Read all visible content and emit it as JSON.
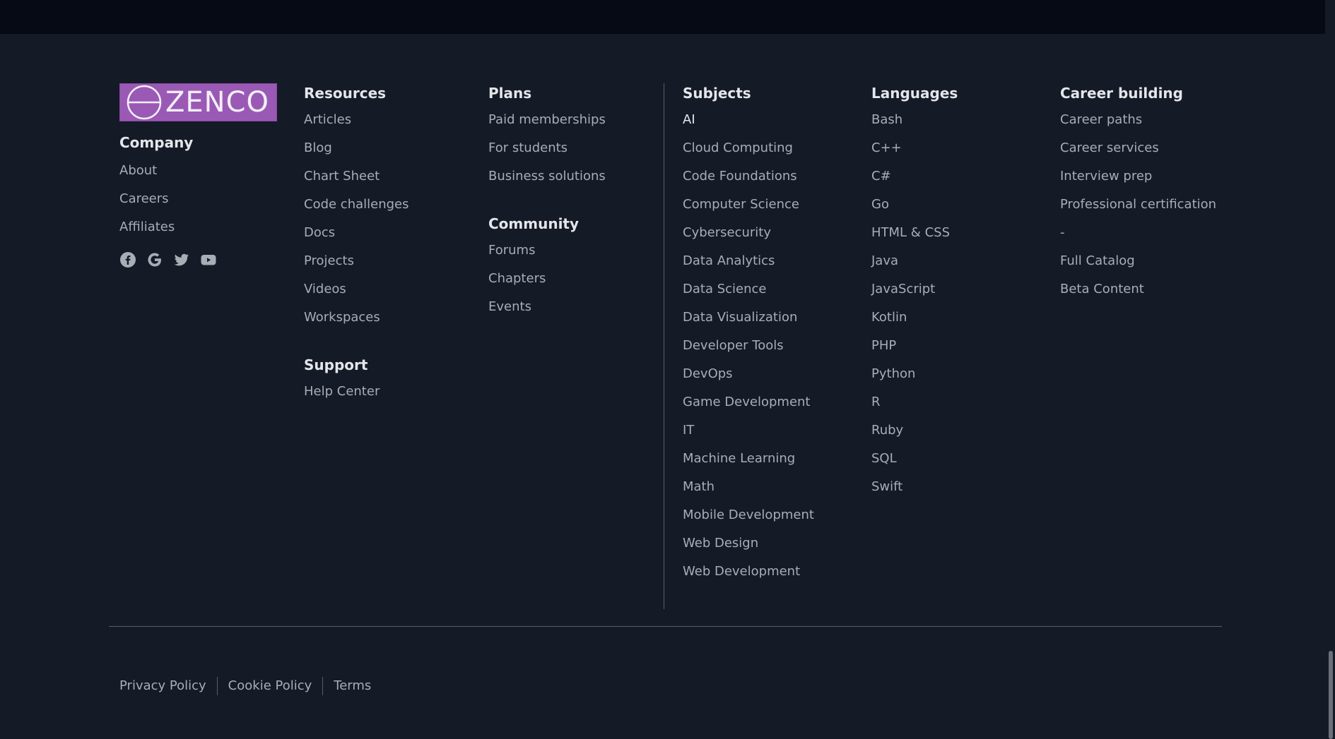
{
  "brand": {
    "logo_text": "ZENCO",
    "logo_color": "#9b59b6"
  },
  "company": {
    "heading": "Company",
    "links": [
      "About",
      "Careers",
      "Affiliates"
    ],
    "social_icons": [
      "facebook-icon",
      "google-icon",
      "twitter-icon",
      "youtube-icon"
    ]
  },
  "resources": {
    "heading": "Resources",
    "links": [
      "Articles",
      "Blog",
      "Chart Sheet",
      "Code challenges",
      "Docs",
      "Projects",
      "Videos",
      "Workspaces"
    ]
  },
  "support": {
    "heading": "Support",
    "links": [
      "Help Center"
    ]
  },
  "plans": {
    "heading": "Plans",
    "links": [
      "Paid memberships",
      "For students",
      "Business solutions"
    ]
  },
  "community": {
    "heading": "Community",
    "links": [
      "Forums",
      "Chapters",
      "Events"
    ]
  },
  "subjects": {
    "heading": "Subjects",
    "links": [
      "AI",
      "Cloud Computing",
      "Code Foundations",
      "Computer Science",
      "Cybersecurity",
      "Data Analytics",
      "Data Science",
      "Data Visualization",
      "Developer Tools",
      "DevOps",
      "Game Development",
      "IT",
      "Machine Learning",
      "Math",
      "Mobile Development",
      "Web Design",
      "Web Development"
    ]
  },
  "languages": {
    "heading": "Languages",
    "links": [
      "Bash",
      "C++",
      "C#",
      "Go",
      "HTML & CSS",
      "Java",
      "JavaScript",
      "Kotlin",
      "PHP",
      "Python",
      "R",
      "Ruby",
      "SQL",
      "Swift"
    ]
  },
  "career": {
    "heading": "Career building",
    "links": [
      "Career paths",
      "Career services",
      "Interview prep",
      "Professional certification",
      "-",
      "Full Catalog",
      "Beta Content"
    ]
  },
  "legal": {
    "privacy": "Privacy Policy",
    "cookie": "Cookie Policy",
    "terms": "Terms"
  },
  "colors": {
    "background": "#141a26",
    "topbar": "#050a15",
    "text": "#a9adb5",
    "heading": "#e4e6ea",
    "divider": "#5a5e66"
  }
}
